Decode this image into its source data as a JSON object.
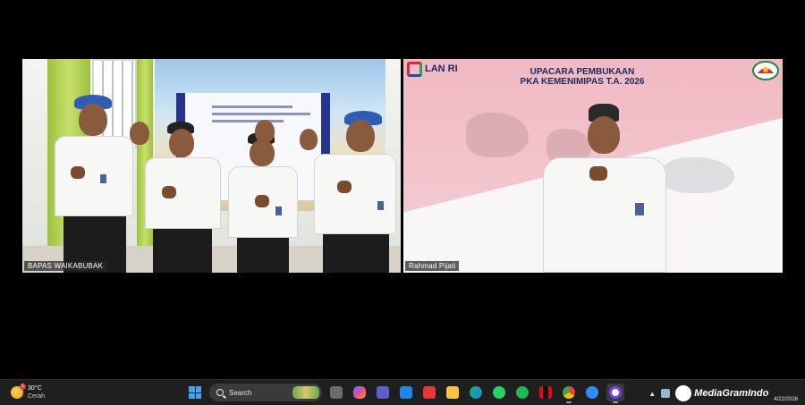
{
  "meeting": {
    "left_tile": {
      "participant_name": "BAPAS WAIKABUBAK"
    },
    "right_tile": {
      "participant_name": "Rahmad Pijati",
      "logo_text": "LAN RI",
      "title_line1": "UPACARA PEMBUKAAN",
      "title_line2": "PKA KEMENIMIPAS T.A. 2026"
    }
  },
  "taskbar": {
    "weather": {
      "temperature": "30°C",
      "condition": "Cerah",
      "alert_count": "1"
    },
    "search_label": "Search",
    "apps": [
      "windows-start",
      "file-explorer",
      "copilot",
      "teams",
      "mail",
      "app-red",
      "folder",
      "edge",
      "whatsapp",
      "spotify",
      "netflix",
      "chrome",
      "zoom",
      "media-player"
    ],
    "watermark": "MediaGramIndo",
    "date": "4/22/2026"
  },
  "colors": {
    "taskbar_bg": "#1f1f1f",
    "accent": "#3ea6f0",
    "flag_red": "#f0b9c3"
  }
}
